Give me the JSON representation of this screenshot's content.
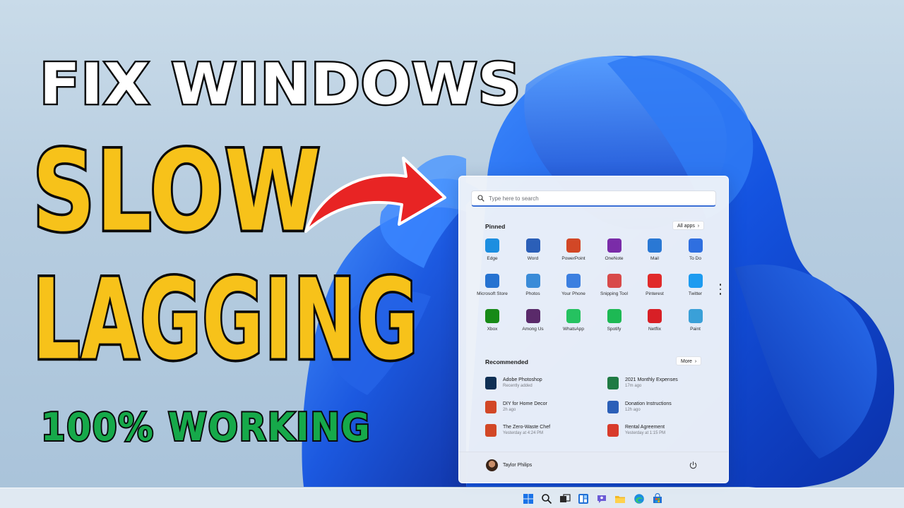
{
  "headline": {
    "line1": "FIX WINDOWS",
    "line2": "SLOW",
    "line3": "LAGGING",
    "line4": "100% WORKING"
  },
  "start_menu": {
    "search_placeholder": "Type here to search",
    "pinned_title": "Pinned",
    "all_apps_label": "All apps",
    "pinned_apps": [
      {
        "label": "Edge",
        "icon": "edge-icon",
        "color": "#1c8ee0"
      },
      {
        "label": "Word",
        "icon": "word-icon",
        "color": "#2b5fb8"
      },
      {
        "label": "PowerPoint",
        "icon": "powerpoint-icon",
        "color": "#d24726"
      },
      {
        "label": "OneNote",
        "icon": "onenote-icon",
        "color": "#7a2ca8"
      },
      {
        "label": "Mail",
        "icon": "mail-icon",
        "color": "#2a78d4"
      },
      {
        "label": "To Do",
        "icon": "todo-icon",
        "color": "#2f6fe0"
      },
      {
        "label": "Microsoft Store",
        "icon": "store-icon",
        "color": "#2572d1"
      },
      {
        "label": "Photos",
        "icon": "photos-icon",
        "color": "#3a8bd8"
      },
      {
        "label": "Your Phone",
        "icon": "phone-icon",
        "color": "#3b7fe0"
      },
      {
        "label": "Snipping Tool",
        "icon": "snipping-tool-icon",
        "color": "#d84a4a"
      },
      {
        "label": "Pinterest",
        "icon": "pinterest-icon",
        "color": "#e02a2a"
      },
      {
        "label": "Twitter",
        "icon": "twitter-icon",
        "color": "#1d9bf0"
      },
      {
        "label": "Xbox",
        "icon": "xbox-icon",
        "color": "#178a17"
      },
      {
        "label": "Among Us",
        "icon": "among-us-icon",
        "color": "#5a2a6a"
      },
      {
        "label": "WhatsApp",
        "icon": "whatsapp-icon",
        "color": "#25c260"
      },
      {
        "label": "Spotify",
        "icon": "spotify-icon",
        "color": "#1db954"
      },
      {
        "label": "Netflix",
        "icon": "netflix-icon",
        "color": "#d81f26"
      },
      {
        "label": "Paint",
        "icon": "paint-icon",
        "color": "#3aa0d8"
      }
    ],
    "recommended_title": "Recommended",
    "more_label": "More",
    "recommended": [
      {
        "name": "Adobe Photoshop",
        "meta": "Recently added",
        "icon": "photoshop-icon",
        "color": "#0f2f54"
      },
      {
        "name": "2021 Monthly Expenses",
        "meta": "17m ago",
        "icon": "excel-icon",
        "color": "#1f7a43"
      },
      {
        "name": "DIY for Home Decor",
        "meta": "2h ago",
        "icon": "powerpoint-file-icon",
        "color": "#d24726"
      },
      {
        "name": "Donation Instructions",
        "meta": "12h ago",
        "icon": "word-file-icon",
        "color": "#2b5fb8"
      },
      {
        "name": "The Zero-Waste Chef",
        "meta": "Yesterday at 4:24 PM",
        "icon": "powerpoint-file-icon",
        "color": "#d24726"
      },
      {
        "name": "Rental Agreement",
        "meta": "Yesterday at 1:15 PM",
        "icon": "pdf-file-icon",
        "color": "#d83b2b"
      }
    ],
    "user_name": "Taylor Philips"
  },
  "taskbar": {
    "icons": [
      "start-icon",
      "search-icon",
      "task-view-icon",
      "widgets-icon",
      "chat-icon",
      "file-explorer-icon",
      "edge-icon",
      "store-icon"
    ]
  }
}
